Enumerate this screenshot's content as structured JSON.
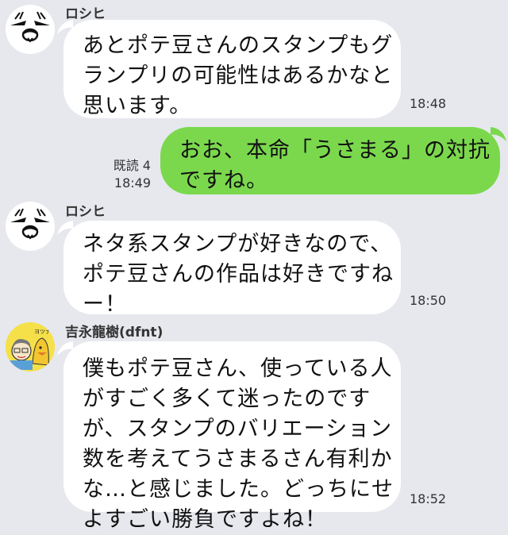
{
  "chat": {
    "background": "#e6e8ee",
    "incoming_bubble_color": "#ffffff",
    "outgoing_bubble_color": "#7bd84d",
    "messages": [
      {
        "sender": "ロシヒ",
        "avatar": "rabbit-face-avatar",
        "lines": [
          "あとポテ豆さんのスタンプもグ",
          "ランプリの可能性はあるかなと",
          "思います。"
        ],
        "time": "18:48"
      },
      {
        "sender": "",
        "lines": [
          "おお、本命「うさまる」の対抗",
          "ですね。"
        ],
        "read_label": "既読 4",
        "time": "18:49"
      },
      {
        "sender": "ロシヒ",
        "avatar": "rabbit-face-avatar",
        "lines": [
          "ネタ系スタンプが好きなので、",
          "ポテ豆さんの作品は好きですね",
          "ー！"
        ],
        "time": "18:50"
      },
      {
        "sender": "吉永龍樹(dfnt)",
        "avatar": "cartoon-portrait-avatar",
        "avatar_caption": "ヨツナガ",
        "lines": [
          "僕もポテ豆さん、使っている人",
          "がすごく多くて迷ったのです",
          "が、スタンプのバリエーション",
          "数を考えてうさまるさん有利か",
          "な…と感じました。どっちにせ",
          "よすごい勝負ですよね！"
        ],
        "time": "18:52"
      }
    ]
  }
}
